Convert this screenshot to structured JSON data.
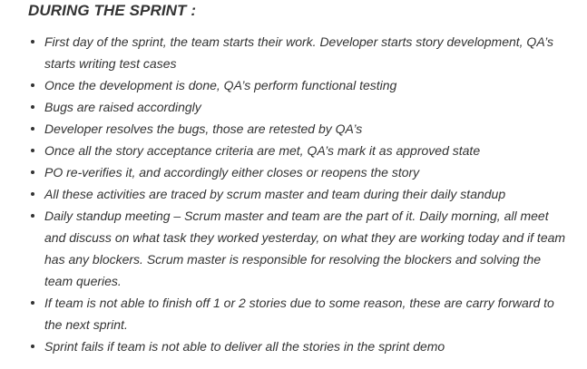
{
  "heading": "DURING THE SPRINT :",
  "items": [
    "First day of the sprint, the team starts their work. Developer starts story development, QA’s starts writing test cases",
    "Once the development is done, QA’s perform functional testing",
    "Bugs are raised accordingly",
    "Developer resolves the bugs, those are retested by QA’s",
    "Once all the story acceptance criteria are met, QA’s mark it as approved state",
    "PO re-verifies it, and accordingly either closes or reopens the story",
    "All these activities are traced by scrum master and team during their daily standup",
    "Daily standup meeting – Scrum master and team are the part of it. Daily morning, all meet and discuss on what task they worked yesterday, on what they are working today and if team has any blockers. Scrum master is responsible for resolving the blockers and solving the team queries.",
    "If team is not able to finish off 1 or 2 stories due to some reason, these are carry forward to the next sprint.",
    "Sprint fails if team is not able to deliver all the stories in the sprint demo"
  ]
}
